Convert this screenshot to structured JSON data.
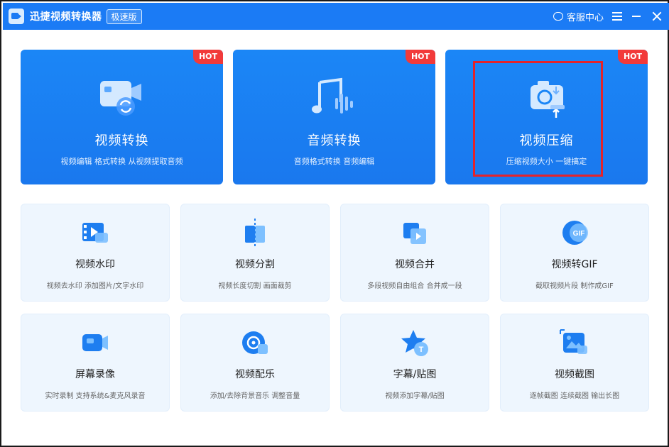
{
  "titlebar": {
    "app_name": "迅捷视频转换器",
    "edition": "极速版",
    "support_label": "客服中心"
  },
  "feature_cards": [
    {
      "title": "视频转换",
      "subtitle": "视频编辑 格式转换 从视频提取音频",
      "badge": "HOT",
      "icon": "video-convert-icon"
    },
    {
      "title": "音频转换",
      "subtitle": "音频格式转换 音频编辑",
      "badge": "HOT",
      "icon": "audio-convert-icon"
    },
    {
      "title": "视频压缩",
      "subtitle": "压缩视频大小 一键搞定",
      "badge": "HOT",
      "icon": "video-compress-icon"
    }
  ],
  "tools": [
    {
      "title": "视频水印",
      "subtitle": "视频去水印 添加图片/文字水印",
      "icon": "watermark-icon"
    },
    {
      "title": "视频分割",
      "subtitle": "视频长度切割 画面裁剪",
      "icon": "split-icon"
    },
    {
      "title": "视频合并",
      "subtitle": "多段视频自由组合 合并成一段",
      "icon": "merge-icon"
    },
    {
      "title": "视频转GIF",
      "subtitle": "截取视频片段 制作成GIF",
      "icon": "gif-icon"
    },
    {
      "title": "屏幕录像",
      "subtitle": "实时录制 支持系统&麦克风录音",
      "icon": "screen-record-icon"
    },
    {
      "title": "视频配乐",
      "subtitle": "添加/去除背景音乐 调整音量",
      "icon": "music-icon"
    },
    {
      "title": "字幕/贴图",
      "subtitle": "视频添加字幕/贴图",
      "icon": "subtitle-icon"
    },
    {
      "title": "视频截图",
      "subtitle": "逐帧截图 连续截图 输出长图",
      "icon": "screenshot-icon"
    }
  ],
  "colors": {
    "brand": "#1b7bf5",
    "hot": "#f23a3a",
    "highlight": "#e3232a",
    "tool_bg": "#eef6fe"
  }
}
